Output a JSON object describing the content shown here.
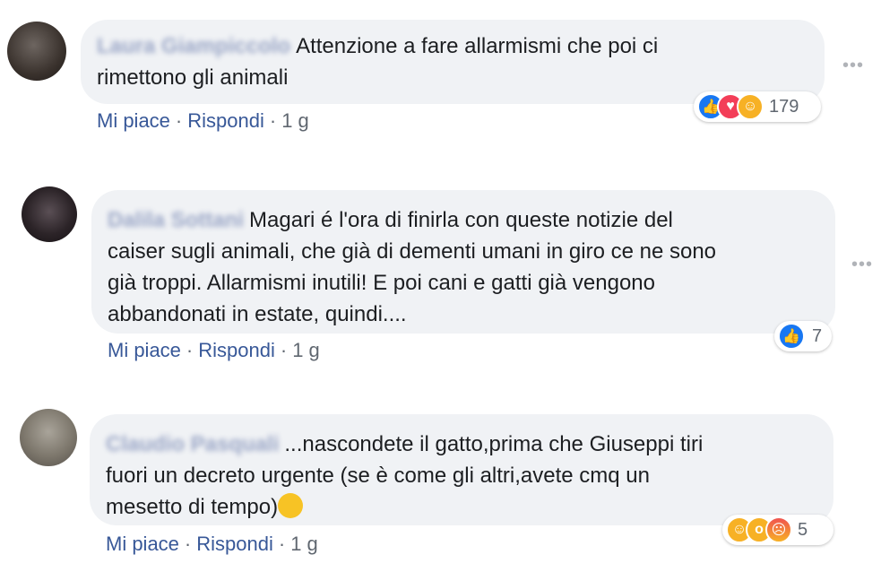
{
  "comments": [
    {
      "author": "Laura Giampiccolo",
      "text_line1": "Attenzione a fare allarmismi che poi ci",
      "text_line2": "rimettono gli animali",
      "actions": {
        "like": "Mi piace",
        "reply": "Rispondi",
        "time": "1 g"
      },
      "reactions": {
        "icons": [
          "like-icon",
          "love-icon",
          "care-icon"
        ],
        "count": "179"
      }
    },
    {
      "author": "Dalila Sottani",
      "text_line1": "Magari é l'ora di finirla con queste notizie del",
      "text_line2": "caiser sugli animali, che già di dementi umani in giro ce ne sono",
      "text_line3": "già troppi. Allarmismi inutili! E poi cani e gatti già vengono",
      "text_line4": "abbandonati in estate, quindi....",
      "actions": {
        "like": "Mi piace",
        "reply": "Rispondi",
        "time": "1 g"
      },
      "reactions": {
        "icons": [
          "like-icon"
        ],
        "count": "7"
      }
    },
    {
      "author": "Claudio Pasquali",
      "text_line1": "...nascondete il gatto,prima che Giuseppi tiri",
      "text_line2": "fuori un decreto urgente (se è come gli altri,avete cmq un",
      "text_line3": "mesetto di tempo)",
      "actions": {
        "like": "Mi piace",
        "reply": "Rispondi",
        "time": "1 g"
      },
      "reactions": {
        "icons": [
          "haha-icon",
          "wow-icon",
          "angry-icon"
        ],
        "count": "5"
      }
    }
  ],
  "menu_glyph": "•••",
  "separator": "·",
  "colors": {
    "link": "#385898",
    "bubble": "#f0f2f5",
    "like": "#1877f2",
    "love": "#f33e58",
    "yellow": "#f7b125"
  }
}
